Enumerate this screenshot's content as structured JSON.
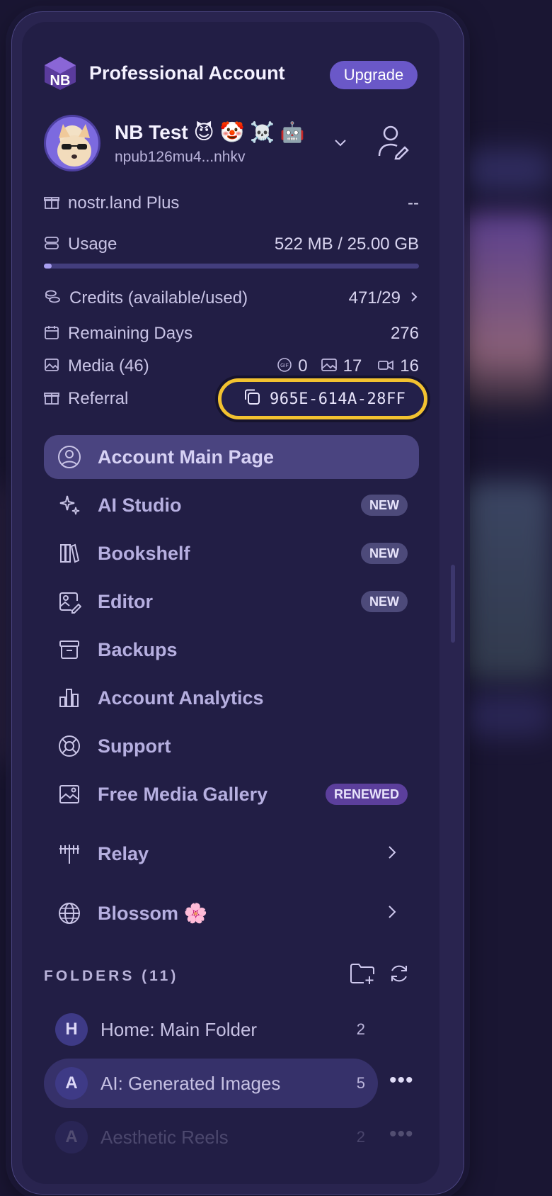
{
  "header": {
    "logo_text": "NB",
    "title": "Professional Account",
    "upgrade_label": "Upgrade"
  },
  "user": {
    "name": "NB Test 😈 🤡 ☠️ 🤖",
    "npub": "npub126mu4...nhkv"
  },
  "stats": {
    "plan_label": "nostr.land Plus",
    "plan_value": "--",
    "usage_label": "Usage",
    "usage_value": "522 MB / 25.00 GB",
    "usage_fraction": 0.02,
    "credits_label": "Credits (available/used)",
    "credits_value": "471/29",
    "remaining_label": "Remaining Days",
    "remaining_value": "276",
    "media_label": "Media (46)",
    "media_gif": "0",
    "media_images": "17",
    "media_videos": "16",
    "referral_label": "Referral",
    "referral_code": "965E-614A-28FF"
  },
  "nav": [
    {
      "label": "Account Main Page",
      "icon": "user-circle-icon",
      "badge": ""
    },
    {
      "label": "AI Studio",
      "icon": "sparkles-icon",
      "badge": "NEW"
    },
    {
      "label": "Bookshelf",
      "icon": "books-icon",
      "badge": "NEW"
    },
    {
      "label": "Editor",
      "icon": "image-edit-icon",
      "badge": "NEW"
    },
    {
      "label": "Backups",
      "icon": "archive-icon",
      "badge": ""
    },
    {
      "label": "Account Analytics",
      "icon": "bar-chart-icon",
      "badge": ""
    },
    {
      "label": "Support",
      "icon": "lifebuoy-icon",
      "badge": ""
    },
    {
      "label": "Free Media Gallery",
      "icon": "gallery-icon",
      "badge": "RENEWED"
    },
    {
      "label": "Relay",
      "icon": "antenna-icon",
      "badge": ""
    },
    {
      "label": "Blossom 🌸",
      "icon": "globe-icon",
      "badge": ""
    }
  ],
  "folders": {
    "title": "FOLDERS (11)",
    "items": [
      {
        "letter": "H",
        "name": "Home: Main Folder",
        "count": "2"
      },
      {
        "letter": "A",
        "name": "AI: Generated Images",
        "count": "5"
      },
      {
        "letter": "A",
        "name": "Aesthetic Reels",
        "count": "2"
      }
    ],
    "more_label": "•••"
  },
  "colors": {
    "panel_bg": "#221e45",
    "accent": "#6a58c8",
    "highlight_ring": "#f2c230"
  }
}
